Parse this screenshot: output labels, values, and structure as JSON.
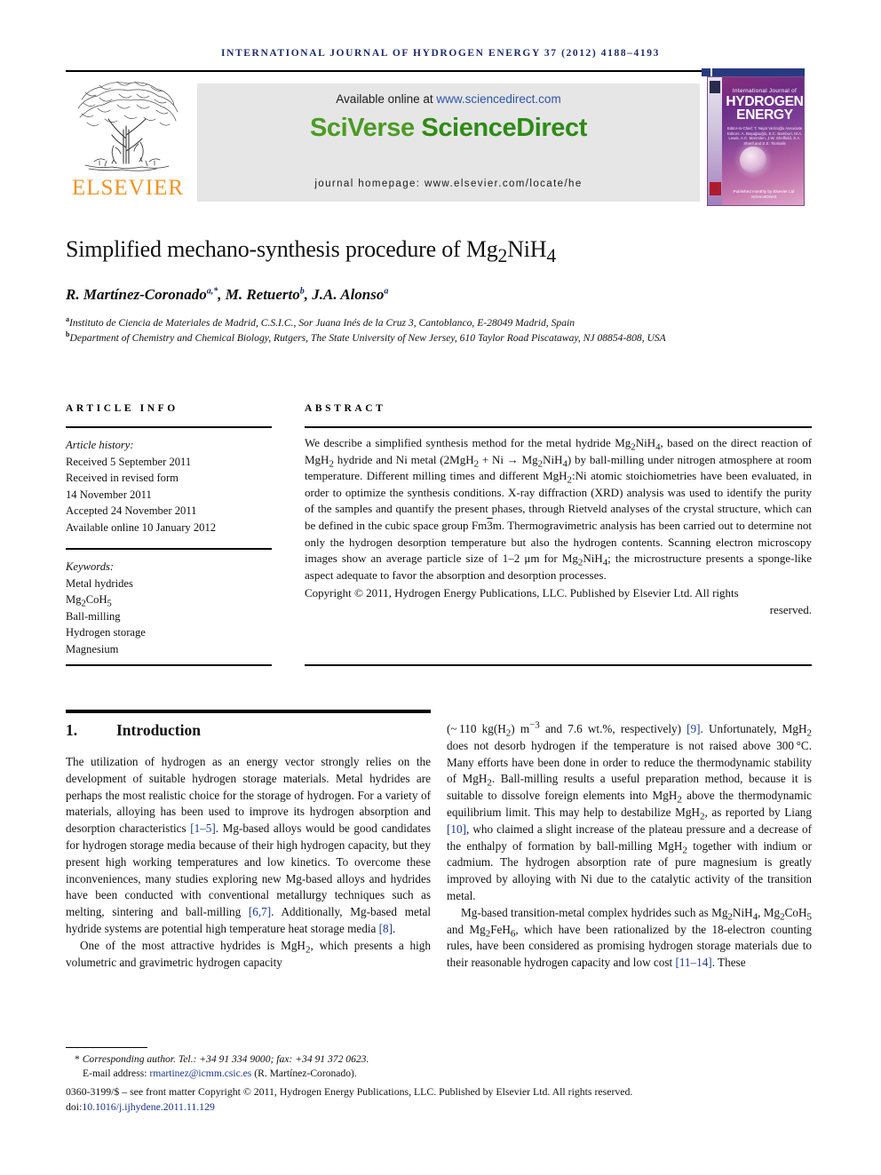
{
  "running_head": "INTERNATIONAL JOURNAL OF HYDROGEN ENERGY 37 (2012) 4188–4193",
  "publisher": {
    "name": "ELSEVIER",
    "logo_icon": "elsevier-tree-logo",
    "brand_color": "#f29222"
  },
  "banner": {
    "available_prefix": "Available online at ",
    "available_url": "www.sciencedirect.com",
    "brand_part1": "SciVerse ",
    "brand_part2": "ScienceDirect",
    "homepage": "journal homepage: www.elsevier.com/locate/he",
    "background_color": "#e6e6e6",
    "brand_color": "#4a9b23",
    "link_color": "#2b55a8"
  },
  "cover": {
    "line1": "International Journal of",
    "line2": "HYDROGEN",
    "line3": "ENERGY",
    "editors": "Editor-in-Chief: T. Nejat Veziroğlu\nAssociate Editors: A. Başağaoğlu, E.C. Bamburi, M.A. Lewis, A.C. Marmilen, J.W. Sheffield, S.A. Sherif and E.E. Tsotsalis",
    "footer": "Published monthly by Elsevier Ltd\nScienceDirect"
  },
  "article": {
    "title_pre": "Simplified mechano-synthesis procedure of Mg",
    "title_sub1": "2",
    "title_mid": "NiH",
    "title_sub2": "4",
    "authors": [
      {
        "name": "R. Martínez-Coronado",
        "marks": "a,*"
      },
      {
        "name": "M. Retuerto",
        "marks": "b"
      },
      {
        "name": "J.A. Alonso",
        "marks": "a"
      }
    ],
    "affiliations": [
      {
        "mark": "a",
        "text": "Instituto de Ciencia de Materiales de Madrid, C.S.I.C., Sor Juana Inés de la Cruz 3, Cantoblanco, E-28049 Madrid, Spain"
      },
      {
        "mark": "b",
        "text": "Department of Chemistry and Chemical Biology, Rutgers, The State University of New Jersey, 610 Taylor Road Piscataway, NJ 08854-808, USA"
      }
    ]
  },
  "info": {
    "heading": "ARTICLE INFO",
    "history_label": "Article history:",
    "history": [
      "Received 5 September 2011",
      "Received in revised form",
      "14 November 2011",
      "Accepted 24 November 2011",
      "Available online 10 January 2012"
    ],
    "keywords_label": "Keywords:",
    "keywords": [
      "Metal hydrides",
      "Mg2CoH5",
      "Ball-milling",
      "Hydrogen storage",
      "Magnesium"
    ]
  },
  "abstract": {
    "heading": "ABSTRACT",
    "body": "We describe a simplified synthesis method for the metal hydride Mg2NiH4, based on the direct reaction of MgH2 hydride and Ni metal (2MgH2 + Ni → Mg2NiH4) by ball-milling under nitrogen atmosphere at room temperature. Different milling times and different MgH2:Ni atomic stoichiometries have been evaluated, in order to optimize the synthesis conditions. X-ray diffraction (XRD) analysis was used to identify the purity of the samples and quantify the present phases, through Rietveld analyses of the crystal structure, which can be defined in the cubic space group Fm3m. Thermogravimetric analysis has been carried out to determine not only the hydrogen desorption temperature but also the hydrogen contents. Scanning electron microscopy images show an average particle size of 1–2 μm for Mg2NiH4; the microstructure presents a sponge-like aspect adequate to favor the absorption and desorption processes.",
    "copyright": "Copyright © 2011, Hydrogen Energy Publications, LLC. Published by Elsevier Ltd. All rights",
    "copyright_last": "reserved."
  },
  "section": {
    "number": "1.",
    "title": "Introduction"
  },
  "body": {
    "left_paragraph_1": "The utilization of hydrogen as an energy vector strongly relies on the development of suitable hydrogen storage materials. Metal hydrides are perhaps the most realistic choice for the storage of hydrogen. For a variety of materials, alloying has been used to improve its hydrogen absorption and desorption characteristics [1–5]. Mg-based alloys would be good candidates for hydrogen storage media because of their high hydrogen capacity, but they present high working temperatures and low kinetics. To overcome these inconveniences, many studies exploring new Mg-based alloys and hydrides have been conducted with conventional metallurgy techniques such as melting, sintering and ball-milling [6,7]. Additionally, Mg-based metal hydride systems are potential high temperature heat storage media [8].",
    "left_paragraph_2": "One of the most attractive hydrides is MgH2, which presents a high volumetric and gravimetric hydrogen capacity",
    "right_paragraph_1": "(~110 kg(H2) m−3 and 7.6 wt.%, respectively) [9]. Unfortunately, MgH2 does not desorb hydrogen if the temperature is not raised above 300 °C. Many efforts have been done in order to reduce the thermodynamic stability of MgH2. Ball-milling results a useful preparation method, because it is suitable to dissolve foreign elements into MgH2 above the thermodynamic equilibrium limit. This may help to destabilize MgH2, as reported by Liang [10], who claimed a slight increase of the plateau pressure and a decrease of the enthalpy of formation by ball-milling MgH2 together with indium or cadmium. The hydrogen absorption rate of pure magnesium is greatly improved by alloying with Ni due to the catalytic activity of the transition metal.",
    "right_paragraph_2": "Mg-based transition-metal complex hydrides such as Mg2NiH4, Mg2CoH5 and Mg2FeH6, which have been rationalized by the 18-electron counting rules, have been considered as promising hydrogen storage materials due to their reasonable hydrogen capacity and low cost [11–14]. These"
  },
  "footnote": {
    "corresponding_label": "Corresponding author.",
    "contact": " Tel.: +34 91 334 9000; fax: +34 91 372 0623.",
    "email_label": "E-mail address: ",
    "email": "rmartinez@icmm.csic.es",
    "email_suffix": " (R. Martínez-Coronado).",
    "link_color": "#1b3a8f"
  },
  "imprint": {
    "line1": "0360-3199/$ – see front matter Copyright © 2011, Hydrogen Energy Publications, LLC. Published by Elsevier Ltd. All rights reserved.",
    "doi_prefix": "doi:",
    "doi": "10.1016/j.ijhydene.2011.11.129"
  }
}
